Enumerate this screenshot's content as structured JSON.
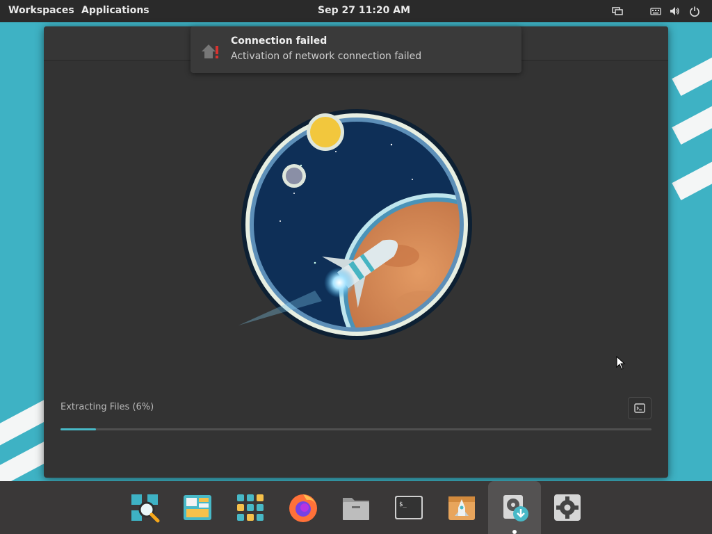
{
  "topbar": {
    "workspaces": "Workspaces",
    "applications": "Applications",
    "clock": "Sep 27  11:20 AM",
    "icons": [
      "display-icon",
      "keyboard-icon",
      "volume-icon",
      "power-icon"
    ]
  },
  "notification": {
    "title": "Connection failed",
    "body": "Activation of network connection failed",
    "icon": "network-error-icon"
  },
  "installer": {
    "status": "Extracting Files (6%)",
    "progress_fraction": 0.06,
    "log_button_icon": "terminal-log-icon"
  },
  "dock": {
    "items": [
      {
        "name": "search-app-icon"
      },
      {
        "name": "window-tiling-icon"
      },
      {
        "name": "applications-grid-icon"
      },
      {
        "name": "firefox-icon"
      },
      {
        "name": "files-icon"
      },
      {
        "name": "terminal-icon"
      },
      {
        "name": "pop-shop-icon"
      },
      {
        "name": "installer-icon",
        "active": true
      },
      {
        "name": "settings-icon"
      }
    ]
  },
  "colors": {
    "accent": "#48b9c7",
    "wallpaper": "#3eb2c4",
    "panel": "#2a2a2a",
    "window": "#333333"
  }
}
